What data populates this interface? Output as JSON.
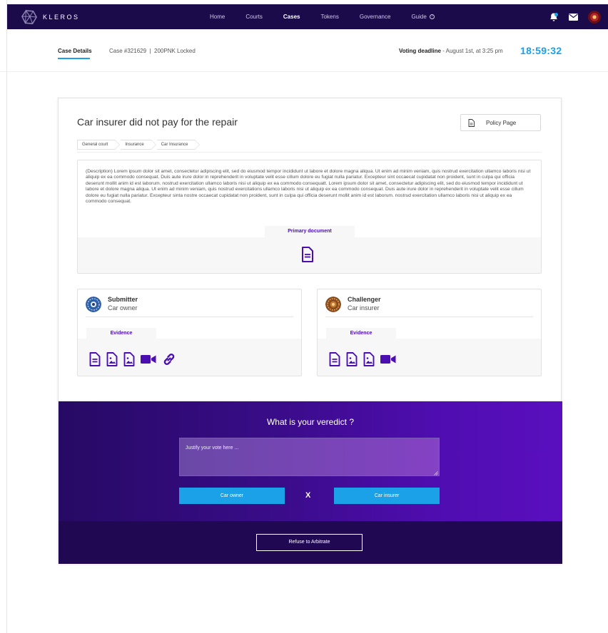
{
  "app": {
    "brand": "KLEROS",
    "colors": {
      "nav_bg": "#1b0b4b",
      "accent_blue": "#1aa1e8",
      "accent_purple": "#4b0fb1"
    }
  },
  "nav": {
    "items": [
      {
        "label": "Home",
        "active": false
      },
      {
        "label": "Courts",
        "active": false
      },
      {
        "label": "Cases",
        "active": true
      },
      {
        "label": "Tokens",
        "active": false
      },
      {
        "label": "Governance",
        "active": false
      },
      {
        "label": "Guide",
        "active": false
      }
    ],
    "icons": [
      "bell-icon",
      "mail-icon",
      "avatar"
    ]
  },
  "casebar": {
    "tab": "Case Details",
    "case_meta": "Case #321629  |  200PNK Locked",
    "deadline_label": "Voting deadline",
    "deadline_value": " - August 1st, at 3:25 pm",
    "timer": "18:59:32"
  },
  "case": {
    "title": "Car insurer did not pay for the repair",
    "policy_button": "Policy Page",
    "breadcrumbs": [
      "General court",
      "Insurance",
      "Car Insurance"
    ],
    "description": "(Description) Lorem ipsum dolor sit amet, consectetur adipiscing elit, sed do eiusmod tempor incididunt ut labore et dolore magna aliqua. Ut enim ad minim veniam, quis nostrud exercitation ullamco laboris nisi ut aliquip ex ea commodo consequat. Duis aute irure dolor in reprehenderit in voluptate velit esse cillum dolore eu fugiat nulla pariatur. Excepteur sint occaecat cupidatat non proident, sunt in culpa qui officia deserunt mollit anim id est laborum. nostrud exercitation ullamco laboris nisi ut aliquip ex ea commodo consequatt. Lorem ipsum dolor sit amet, consectetur adipiscing elit, sed do eiusmod tempor incididunt ut labore et dolore magna aliqua. Ut enim ad minim veniam, quis nostrud exercitations ullamco laboris nisi ut aliquip ex ea commodo consequat. Duis aute irure dolor in reprehenderit in voluptate velit esse cillum dolore eu fugiat nulla pariatur. Excepteur sinta nostre occaecat cupidatat non proident, sunt in culpa qui officia deserunt mollit anim id est laborum. nostrud exercitation ullamco laboris nisi ut aliquip ex ea commodo consequat.",
    "primary_document": "Primary document"
  },
  "submitter": {
    "role": "Submitter",
    "name": "Car owner",
    "evidence_tab": "Evidence",
    "evidence_icons": [
      "document-icon",
      "image-icon",
      "image-icon",
      "video-icon",
      "link-icon"
    ]
  },
  "challenger": {
    "role": "Challenger",
    "name": "Car insurer",
    "evidence_tab": "Evidence",
    "evidence_icons": [
      "document-icon",
      "image-icon",
      "image-icon",
      "video-icon"
    ]
  },
  "verdict": {
    "title": "What is your veredict ?",
    "justify_placeholder": "Justify your vote here ...",
    "option_a": "Car owner",
    "separator": "X",
    "option_b": "Car insurer",
    "refuse": "Refuse to Arbitrate"
  }
}
